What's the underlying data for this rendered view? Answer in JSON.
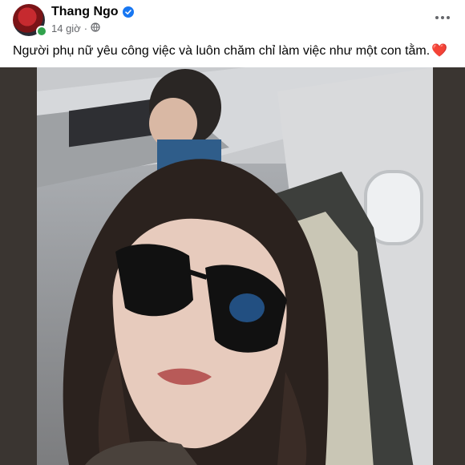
{
  "post": {
    "author": "Thang Ngo",
    "timestamp": "14 giờ",
    "separator": "·",
    "privacy_icon": "globe-icon",
    "verified_icon": "verified-badge-icon",
    "more_icon": "more-options-icon",
    "caption": "Người phụ nữ yêu công việc và luôn chăm chỉ làm việc như một con tằm.",
    "caption_emoji": "❤️",
    "accent": "#1877f2",
    "online_color": "#31a24c"
  }
}
